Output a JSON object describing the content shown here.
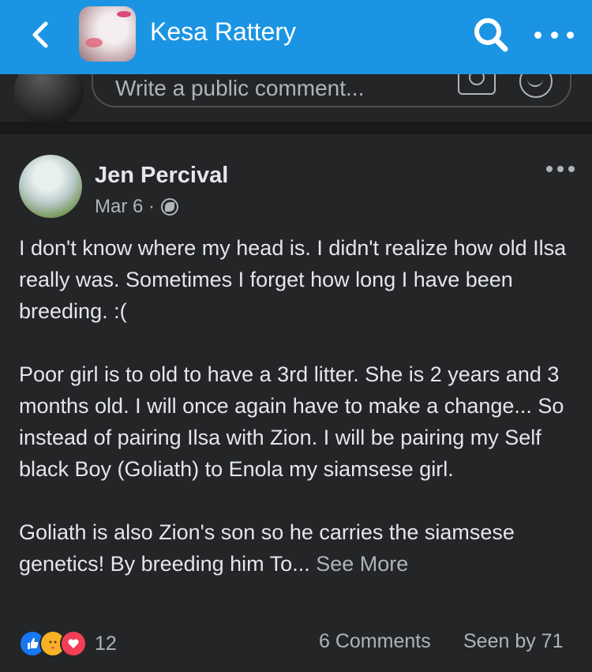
{
  "header": {
    "title": "Kesa Rattery",
    "background": "#1b95e3",
    "back_icon": "chevron-left-icon",
    "search_icon": "search-icon",
    "more_icon": "more-dots-icon"
  },
  "comment_bar": {
    "placeholder": "Write a public comment..."
  },
  "post": {
    "author": "Jen Percival",
    "date": "Mar 6 ·",
    "privacy_icon": "globe-icon",
    "paragraphs": [
      "I don't know where my head is.  I didn't realize how old Ilsa really was. Sometimes I forget how long I have been breeding. :(",
      "Poor girl is to old to have a 3rd litter. She is 2 years and 3 months old. I will once again have to make a change... So instead of pairing Ilsa with Zion. I will be pairing my Self black Boy (Goliath) to Enola my siamsese girl.",
      "Goliath is also Zion's son so he carries the siamsese genetics! By breeding him To..."
    ],
    "see_more": "See More",
    "reactions_count": "12",
    "comments": "6 Comments",
    "seen_by": "Seen by 71"
  }
}
